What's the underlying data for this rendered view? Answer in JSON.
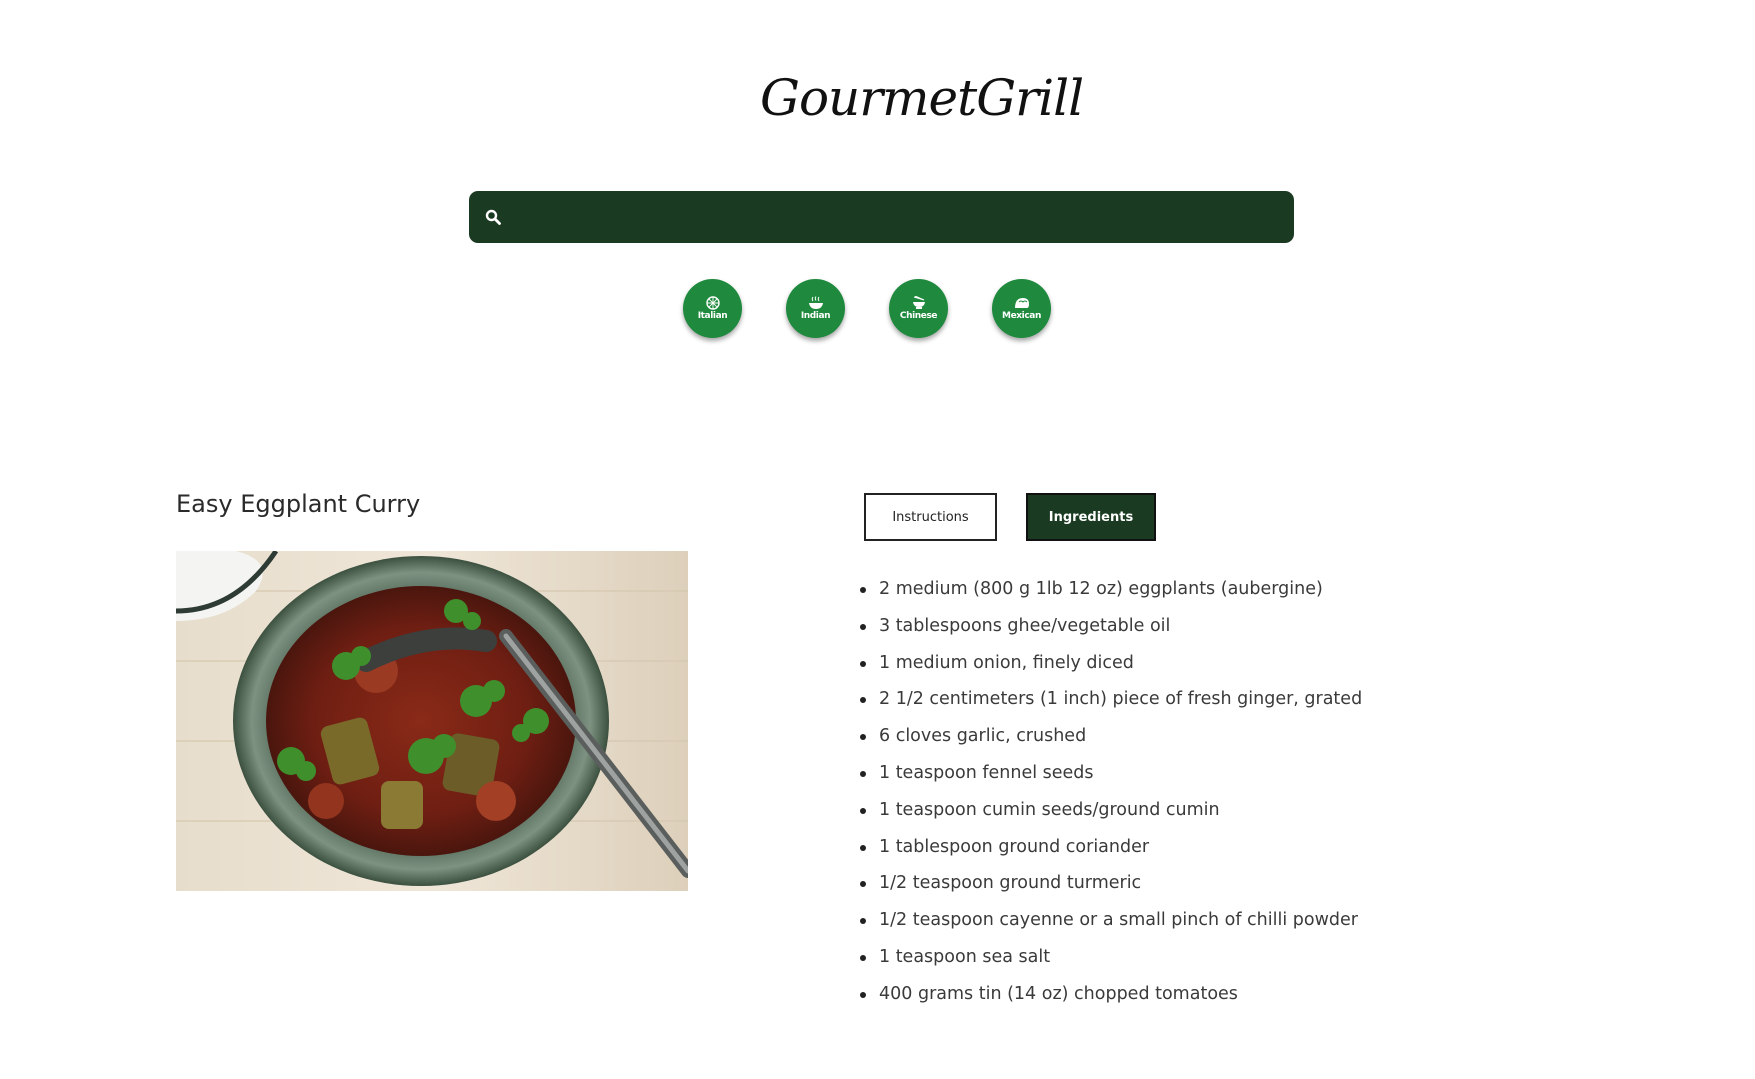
{
  "brand": {
    "name": "GourmetGrill"
  },
  "search": {
    "value": "",
    "placeholder": ""
  },
  "cuisines": [
    {
      "label": "Italian",
      "icon": "pizza-icon"
    },
    {
      "label": "Indian",
      "icon": "curry-bowl-icon"
    },
    {
      "label": "Chinese",
      "icon": "noodle-bowl-icon"
    },
    {
      "label": "Mexican",
      "icon": "taco-icon"
    }
  ],
  "recipe": {
    "title": "Easy Eggplant Curry",
    "image_label": "eggplant curry bowl photo"
  },
  "tabs": {
    "instructions": "Instructions",
    "ingredients": "Ingredients",
    "active": "ingredients"
  },
  "ingredients": [
    "2 medium (800 g 1lb 12 oz) eggplants (aubergine)",
    "3 tablespoons ghee/vegetable oil",
    "1 medium onion, finely diced",
    "2 1/2 centimeters (1 inch) piece of fresh ginger, grated",
    "6 cloves garlic, crushed",
    "1 teaspoon fennel seeds",
    "1 teaspoon cumin seeds/ground cumin",
    "1 tablespoon ground coriander",
    "1/2 teaspoon ground turmeric",
    "1/2 teaspoon cayenne or a small pinch of chilli powder",
    "1 teaspoon sea salt",
    "400 grams tin (14 oz) chopped tomatoes"
  ],
  "colors": {
    "primary_dark": "#1a3a22",
    "cuisine_green": "#1f8a3e"
  }
}
